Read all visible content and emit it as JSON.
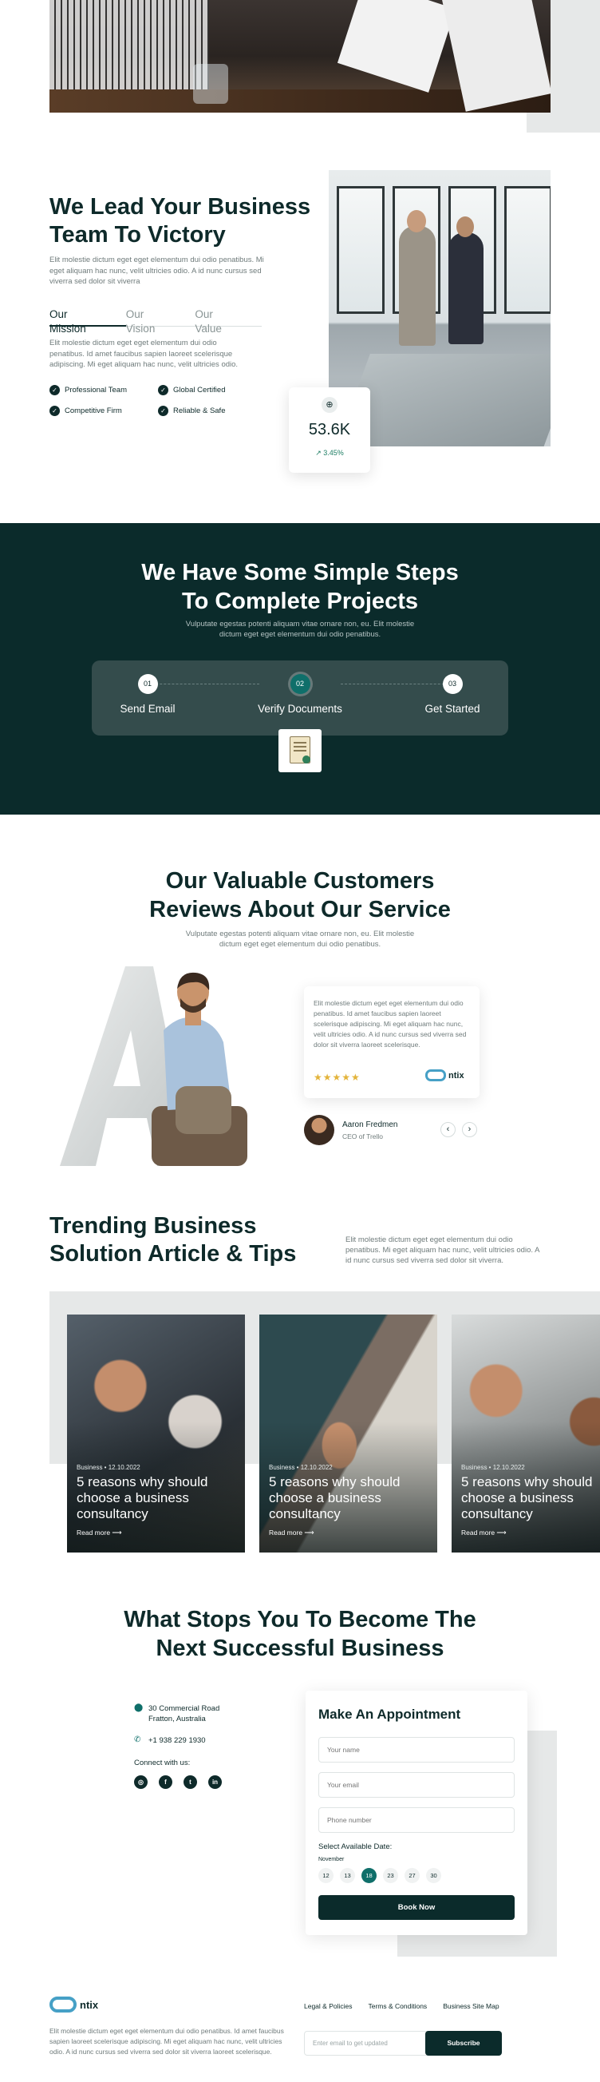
{
  "about": {
    "title_line1": "We Lead Your Business",
    "title_line2": "Team To Victory",
    "description": "Elit molestie dictum eget eget elementum dui odio penatibus. Mi eget aliquam hac nunc, velit ultricies odio. A id nunc cursus sed viverra sed dolor sit viverra",
    "tabs": [
      "Our Mission",
      "Our Vision",
      "Our Value"
    ],
    "active_tab": "Our Mission",
    "tab_description": "Elit molestie dictum eget eget elementum dui odio penatibus. Id amet faucibus sapien laoreet scelerisque adipiscing. Mi eget aliquam hac nunc, velit ultricies odio.",
    "features": [
      "Professional Team",
      "Global Certified",
      "Competitive Firm",
      "Reliable & Safe"
    ],
    "stat": {
      "icon": "globe-icon",
      "value": "53.6K",
      "change": "3.45%"
    }
  },
  "steps": {
    "title_line1": "We Have Some Simple Steps",
    "title_line2": "To Complete Projects",
    "desc_line1": "Vulputate egestas potenti aliquam vitae ornare non, eu. Elit molestie",
    "desc_line2": "dictum eget eget elementum dui odio penatibus.",
    "items": [
      {
        "num": "01",
        "label": "Send Email"
      },
      {
        "num": "02",
        "label": "Verify Documents"
      },
      {
        "num": "03",
        "label": "Get Started"
      }
    ]
  },
  "reviews": {
    "title_line1": "Our Valuable Customers",
    "title_line2": "Reviews About Our Service",
    "desc_line1": "Vulputate egestas potenti aliquam vitae ornare non, eu. Elit molestie",
    "desc_line2": "dictum eget eget elementum dui odio penatibus.",
    "quote": "Elit molestie dictum eget eget elementum dui odio penatibus. Id amet faucibus sapien laoreet scelerisque adipiscing. Mi eget aliquam hac nunc, velit ultricies odio. A id nunc cursus sed viverra sed dolor sit viverra laoreet scelerisque.",
    "stars": "★★★★★",
    "company": "ntix",
    "reviewer_name": "Aaron Fredmen",
    "reviewer_role": "CEO of Trello",
    "prev": "‹",
    "next": "›"
  },
  "articles": {
    "title_line1": "Trending Business",
    "title_line2": "Solution Article & Tips",
    "description": "Elit molestie dictum eget eget elementum dui odio penatibus. Mi eget aliquam hac nunc, velit ultricies odio. A id nunc cursus sed viverra sed dolor sit viverra.",
    "items": [
      {
        "meta": "Business  •  12.10.2022",
        "title": "5 reasons why should choose a business consultancy",
        "more": "Read more  ⟶"
      },
      {
        "meta": "Business  •  12.10.2022",
        "title": "5 reasons why should choose a business consultancy",
        "more": "Read more  ⟶"
      },
      {
        "meta": "Business  •  12.10.2022",
        "title": "5 reasons why should choose a business consultancy",
        "more": "Read more  ⟶"
      }
    ]
  },
  "appointment": {
    "title_line1": "What Stops You To Become The",
    "title_line2": "Next Successful Business",
    "address_line1": "30 Commercial Road",
    "address_line2": "Fratton, Australia",
    "phone": "+1 938 229 1930",
    "connect": "Connect with us:",
    "socials": [
      {
        "icon": "instagram-icon",
        "glyph": "◎"
      },
      {
        "icon": "facebook-icon",
        "glyph": "f"
      },
      {
        "icon": "twitter-icon",
        "glyph": "t"
      },
      {
        "icon": "linkedin-icon",
        "glyph": "in"
      }
    ],
    "form_title": "Make An Appointment",
    "name_placeholder": "Your name",
    "email_placeholder": "Your email",
    "phone_placeholder": "Phone number",
    "date_label": "Select Available Date:",
    "month": "November",
    "days": [
      "12",
      "13",
      "18",
      "23",
      "27",
      "30"
    ],
    "selected_day": "18",
    "button": "Book Now"
  },
  "footer": {
    "logo": "ntix",
    "description": "Elit molestie dictum eget eget elementum dui odio penatibus. Id amet faucibus sapien laoreet scelerisque adipiscing. Mi eget aliquam hac nunc, velit ultricies odio. A id nunc cursus sed viverra sed dolor sit viverra laoreet scelerisque.",
    "links": [
      "Legal & Policies",
      "Terms & Conditions",
      "Business Site Map"
    ],
    "subscribe_placeholder": "Enter email to get updated",
    "subscribe_button": "Subscribe"
  },
  "colors": {
    "primary": "#0b2b2b",
    "accent": "#0f6f6a",
    "star": "#e3b43b",
    "logo": "#46a0c6",
    "panel": "#e6e8e8"
  }
}
